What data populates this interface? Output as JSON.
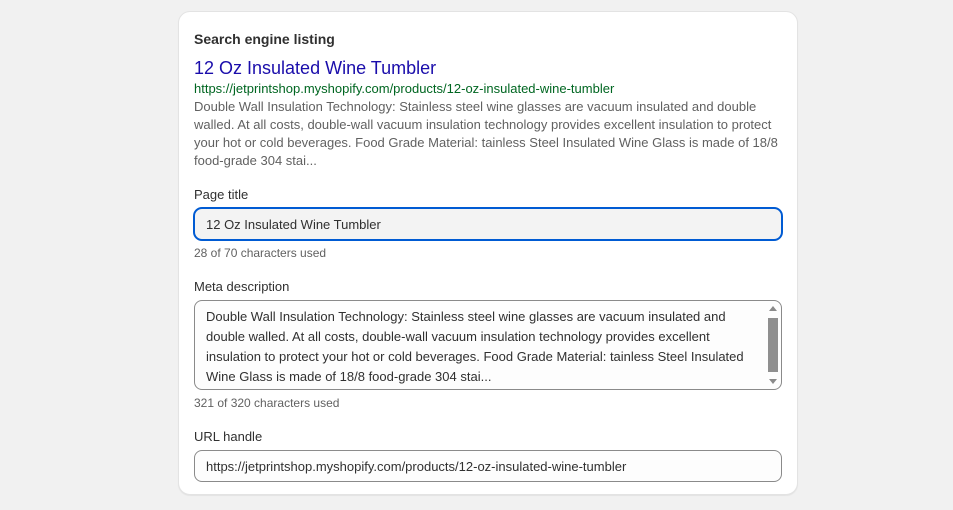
{
  "section": {
    "title": "Search engine listing"
  },
  "preview": {
    "title": "12 Oz Insulated Wine Tumbler",
    "url": "https://jetprintshop.myshopify.com/products/12-oz-insulated-wine-tumbler",
    "description": "Double Wall Insulation Technology: Stainless steel wine glasses are vacuum insulated and double walled. At all costs, double-wall vacuum insulation technology provides excellent insulation to protect your hot or cold beverages. Food Grade Material: tainless Steel Insulated Wine Glass is made of 18/8 food-grade 304 stai..."
  },
  "page_title": {
    "label": "Page title",
    "value": "12 Oz Insulated Wine Tumbler",
    "help": "28 of 70 characters used"
  },
  "meta_description": {
    "label": "Meta description",
    "value": "Double Wall Insulation Technology: Stainless steel wine glasses are vacuum insulated and double walled. At all costs, double-wall vacuum insulation technology provides excellent insulation to protect your hot or cold beverages. Food Grade Material: tainless Steel Insulated Wine Glass is made of 18/8 food-grade 304 stai...",
    "help": "321 of 320 characters used"
  },
  "url_handle": {
    "label": "URL handle",
    "value": "https://jetprintshop.myshopify.com/products/12-oz-insulated-wine-tumbler"
  },
  "colors": {
    "link_title": "#1a0dab",
    "link_url": "#006621",
    "focus_ring": "#005bd3"
  }
}
